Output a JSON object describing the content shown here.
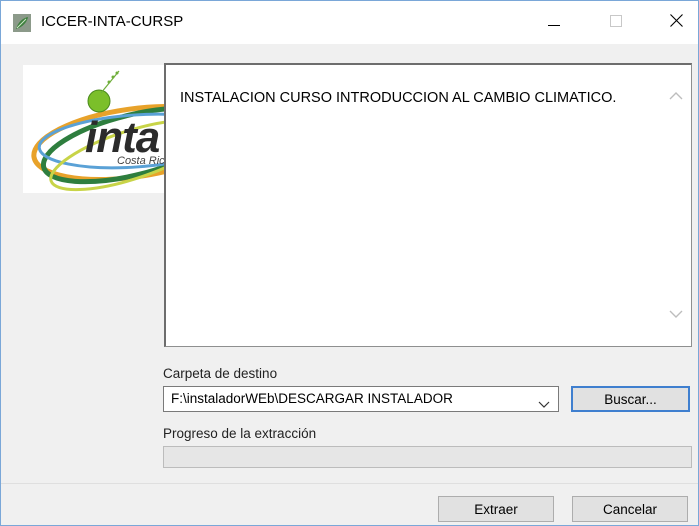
{
  "window": {
    "title": "ICCER-INTA-CURSP"
  },
  "icons": {
    "app": "leaf-icon",
    "minimize": "minimize-icon",
    "maximize": "maximize-icon",
    "close": "close-icon"
  },
  "logo": {
    "text": "inta",
    "subtext": "Costa Rica"
  },
  "message": {
    "text": "INSTALACION CURSO INTRODUCCION AL CAMBIO CLIMATICO."
  },
  "destination": {
    "label": "Carpeta de destino",
    "value": "F:\\instaladorWEb\\DESCARGAR INSTALADOR",
    "browse_label": "Buscar..."
  },
  "progress": {
    "label": "Progreso de la extracción",
    "value": 0
  },
  "footer": {
    "extract_label": "Extraer",
    "cancel_label": "Cancelar"
  }
}
